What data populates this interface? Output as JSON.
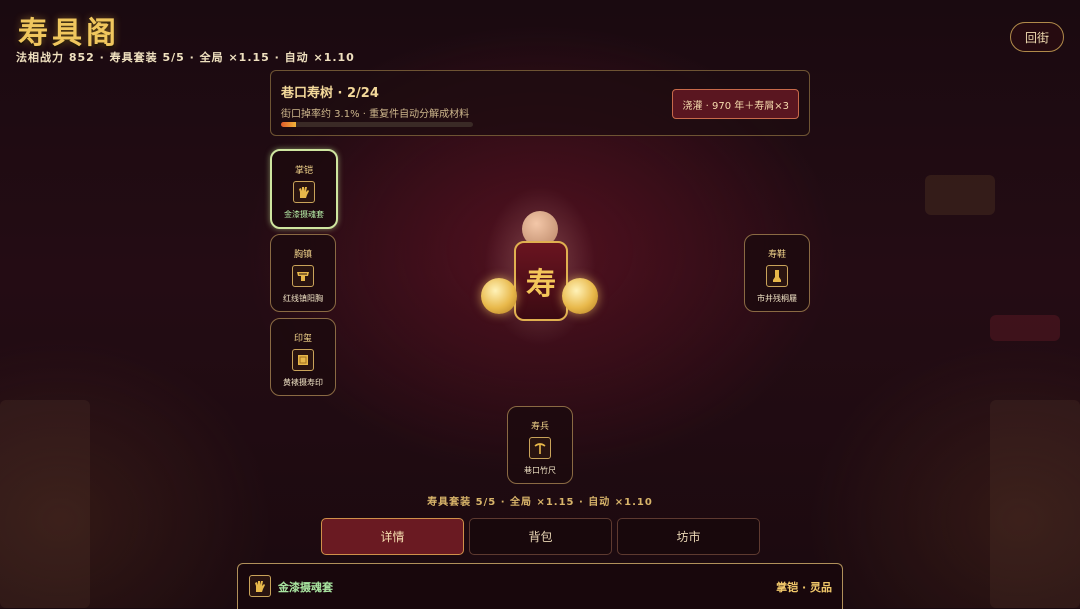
{
  "title": "寿具阁",
  "status_line": "法相战力 852 · 寿具套装 5/5 · 全局 ×1.15 · 自动 ×1.10",
  "back_button": "回街",
  "tree": {
    "name": "巷口寿树 · 2/24",
    "desc": "街口掉率约 3.1% · 重复件自动分解成材料",
    "progress": 0.08,
    "water_button": "浇灌 · 970 年＋寿屑×3"
  },
  "slots": {
    "gauntlet": {
      "type": "掌铠",
      "name": "金漆摄魂套",
      "icon": "gauntlet-icon"
    },
    "chest": {
      "type": "胸镇",
      "name": "红线镇阳胸",
      "icon": "chest-armor-icon"
    },
    "seal": {
      "type": "印玺",
      "name": "黄裱摄寿印",
      "icon": "seal-icon"
    },
    "shoes": {
      "type": "寿鞋",
      "name": "市井残桐屦",
      "icon": "shoe-icon"
    },
    "weapon": {
      "type": "寿兵",
      "name": "巷口竹尺",
      "icon": "ruler-weapon-icon"
    }
  },
  "character": {
    "emblem": "寿"
  },
  "set_line": "寿具套装 5/5 · 全局 ×1.15 · 自动 ×1.10",
  "tabs": [
    "详情",
    "背包",
    "坊市"
  ],
  "active_tab": 0,
  "detail": {
    "name": "金漆摄魂套",
    "tag": "掌铠 · 灵品",
    "icon": "gauntlet-icon"
  },
  "colors": {
    "gold": "#f0c75e",
    "accent_red": "#6a1a22",
    "selected_green": "#b8f0a8"
  }
}
